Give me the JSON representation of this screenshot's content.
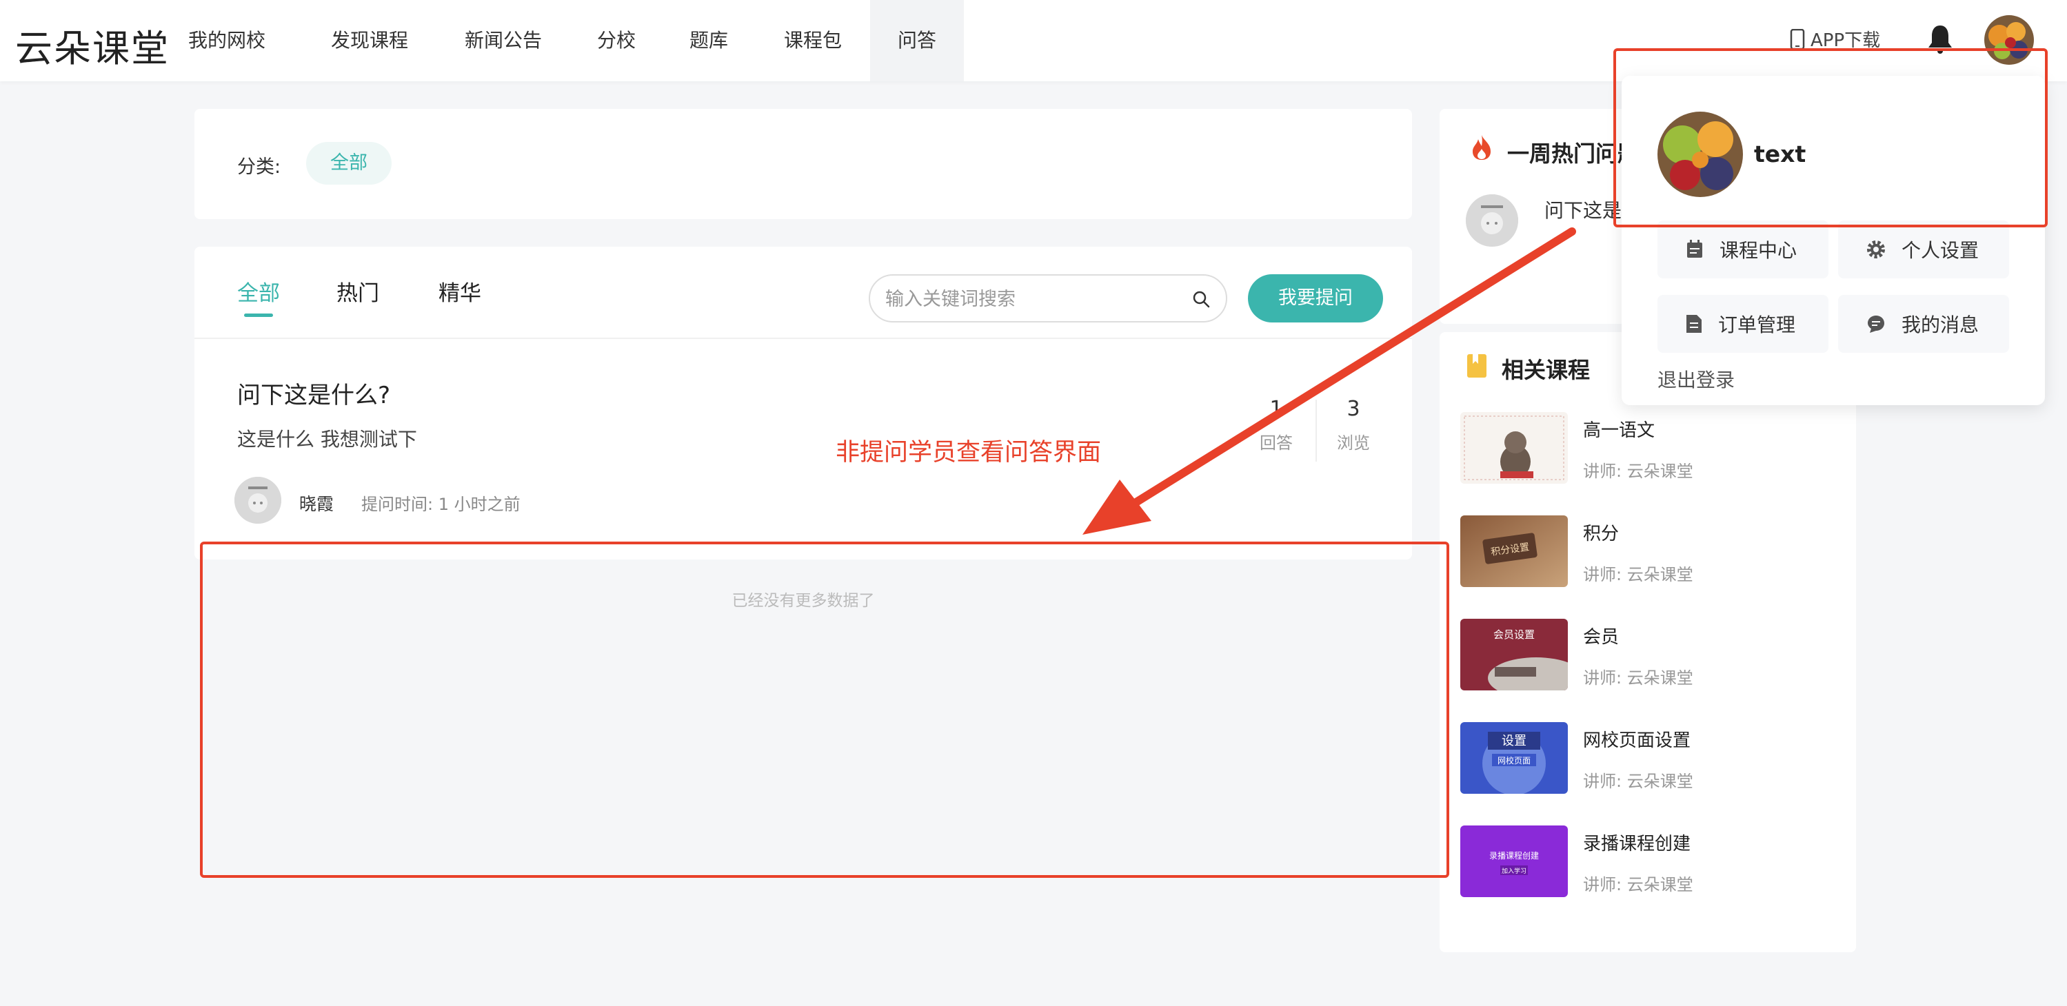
{
  "header": {
    "logo": "云朵课堂",
    "nav": [
      "我的网校",
      "发现课程",
      "新闻公告",
      "分校",
      "题库",
      "课程包",
      "问答"
    ],
    "active_nav": "问答",
    "app_download": "APP下载"
  },
  "category": {
    "label": "分类:",
    "pill": "全部"
  },
  "tabs": [
    "全部",
    "热门",
    "精华"
  ],
  "search": {
    "placeholder": "输入关键词搜索"
  },
  "ask_button": "我要提问",
  "question": {
    "title": "问下这是什么?",
    "desc": "这是什么  我想测试下",
    "user": "晓霞",
    "time": "提问时间:  1 小时之前",
    "answers_count": "1",
    "answers_label": "回答",
    "views_count": "3",
    "views_label": "浏览"
  },
  "no_more": "已经没有更多数据了",
  "annotation": "非提问学员查看问答界面",
  "hot": {
    "title": "一周热门问题",
    "question": "问下这是什么?"
  },
  "courses": {
    "title": "相关课程",
    "items": [
      {
        "name": "高一语文",
        "teacher": "讲师: 云朵课堂"
      },
      {
        "name": "积分",
        "teacher": "讲师: 云朵课堂"
      },
      {
        "name": "会员",
        "teacher": "讲师: 云朵课堂"
      },
      {
        "name": "网校页面设置",
        "teacher": "讲师: 云朵课堂"
      },
      {
        "name": "录播课程创建",
        "teacher": "讲师: 云朵课堂"
      }
    ],
    "thumb_texts": [
      "",
      "积分设置",
      "会员设置",
      "设置",
      "录播课程创建"
    ],
    "thumb_subtexts": [
      "",
      "",
      "",
      "网校页面",
      "加入学习"
    ]
  },
  "dropdown": {
    "username": "text",
    "buttons": [
      "课程中心",
      "个人设置",
      "订单管理",
      "我的消息"
    ],
    "logout": "退出登录"
  },
  "colors": {
    "accent": "#3bb5ad",
    "annotation": "#e8412a"
  }
}
